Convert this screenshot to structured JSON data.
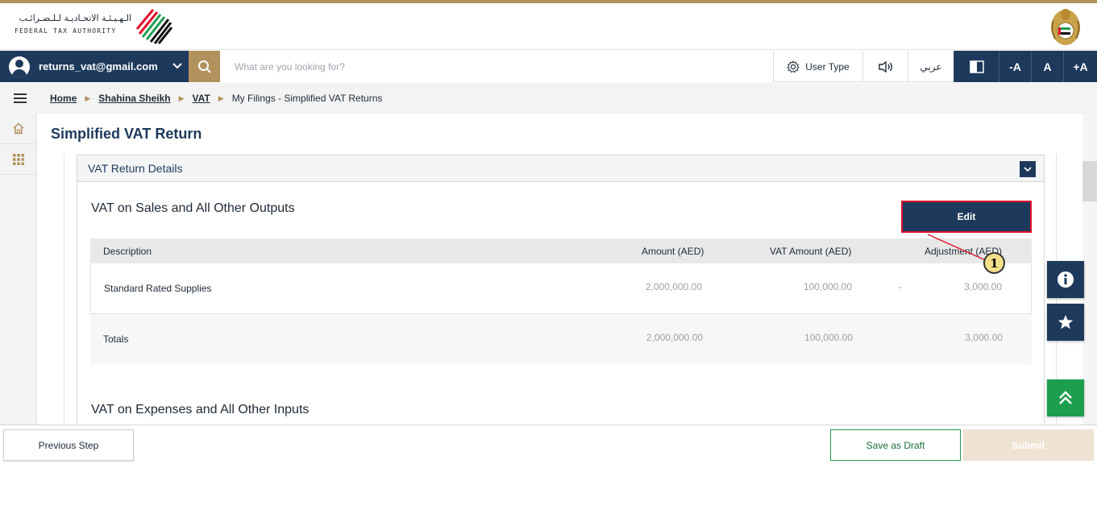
{
  "header": {
    "authority_name_ar": "الـهـيـئـة الاتحـاديـة لـلـضـرائـب",
    "authority_name_en": "FEDERAL TAX AUTHORITY"
  },
  "navbar": {
    "user_email": "returns_vat@gmail.com",
    "search_placeholder": "What are you looking for?",
    "user_type_label": "User Type",
    "language_label": "عربي",
    "font_decrease_label": "-A",
    "font_reset_label": "A",
    "font_increase_label": "+A"
  },
  "breadcrumb": {
    "items": [
      "Home",
      "Shahina Sheikh",
      "VAT"
    ],
    "current": "My Filings - Simplified VAT Returns"
  },
  "page": {
    "title": "Simplified VAT Return"
  },
  "accordion": {
    "title": "VAT Return Details"
  },
  "sales_section": {
    "title": "VAT on Sales and All Other Outputs",
    "edit_label": "Edit",
    "columns": [
      "Description",
      "Amount (AED)",
      "VAT Amount (AED)",
      "Adjustment (AED)"
    ],
    "rows": [
      {
        "description": "Standard Rated Supplies",
        "amount": "2,000,000.00",
        "vat_amount": "100,000.00",
        "adjustment_sign": "-",
        "adjustment": "3,000.00"
      },
      {
        "description": "Totals",
        "amount": "2,000,000.00",
        "vat_amount": "100,000.00",
        "adjustment_sign": "",
        "adjustment": "3,000.00"
      }
    ]
  },
  "expenses_section": {
    "title": "VAT on Expenses and All Other Inputs"
  },
  "annotation": {
    "number": "1"
  },
  "footer": {
    "previous_label": "Previous Step",
    "draft_label": "Save as Draft",
    "submit_label": "Submit"
  },
  "colors": {
    "primary": "#1d3a5c",
    "gold": "#b2925c",
    "green": "#1d9e4f",
    "highlight_border": "#e1122b"
  }
}
